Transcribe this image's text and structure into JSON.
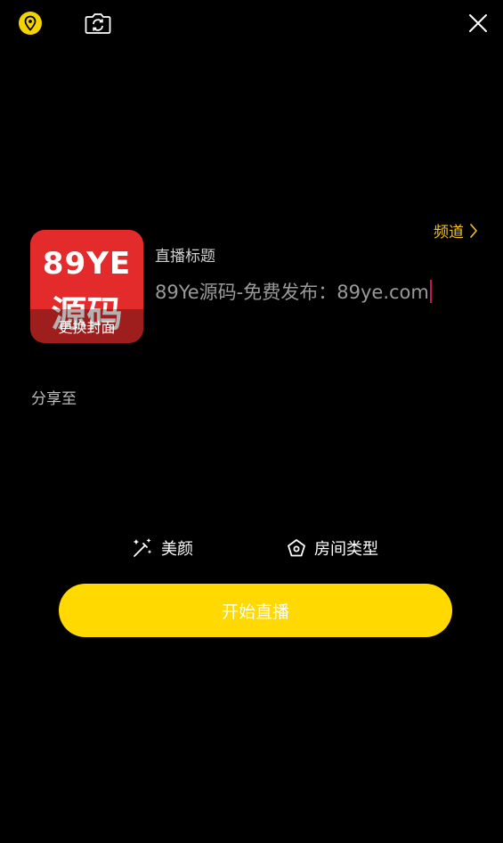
{
  "top_bar": {
    "location_icon": "location-pin-icon",
    "camera_flip_icon": "camera-flip-icon",
    "close_icon": "close-icon"
  },
  "channel": {
    "label": "频道",
    "icon": "chevron-right-icon",
    "color": "#f5c21b"
  },
  "cover": {
    "logo_top": "89YE",
    "logo_bottom": "源码",
    "change_label": "更换封面",
    "background": "#e32b2b"
  },
  "title": {
    "label": "直播标题",
    "value": "89Ye源码-免费发布：89ye.com"
  },
  "share": {
    "label": "分享至"
  },
  "options": {
    "beauty_label": "美颜",
    "beauty_icon": "magic-wand-icon",
    "room_type_label": "房间类型",
    "room_type_icon": "pentagon-icon"
  },
  "start_button": {
    "label": "开始直播",
    "color": "#ffd900"
  }
}
